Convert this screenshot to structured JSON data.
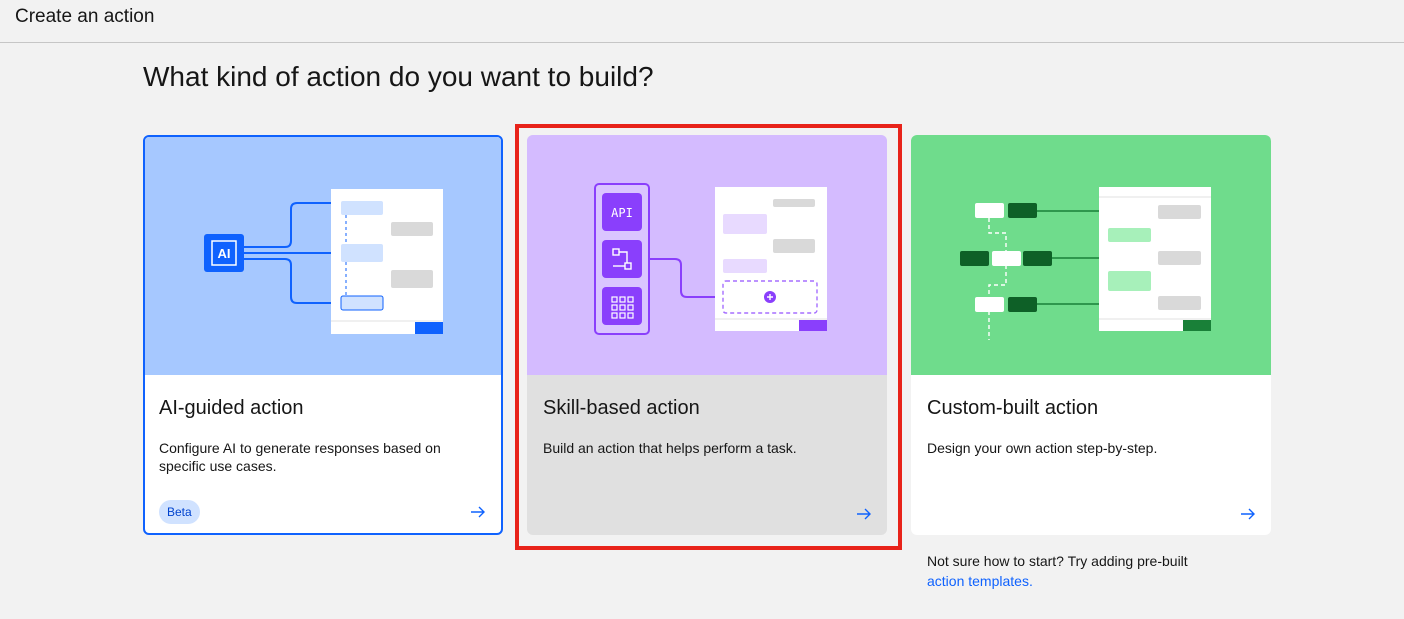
{
  "header": {
    "title": "Create an action"
  },
  "main": {
    "heading": "What kind of action do you want to build?",
    "cards": [
      {
        "title": "AI-guided action",
        "description": "Configure AI to generate responses based on specific use cases.",
        "badge": "Beta",
        "illustration_label": "AI",
        "bg_color": "#a6c8ff",
        "accent": "#0f62fe",
        "selected": false
      },
      {
        "title": "Skill-based action",
        "description": "Build an action that helps perform a task.",
        "illustration_label": "API",
        "bg_color": "#d4bbff",
        "accent": "#8a3ffc",
        "selected": true
      },
      {
        "title": "Custom-built action",
        "description": "Design your own action step-by-step.",
        "bg_color": "#6fdc8c",
        "accent": "#198038",
        "selected": false
      }
    ],
    "hint": {
      "text": "Not sure how to start? Try adding pre-built",
      "link": "action templates."
    }
  }
}
